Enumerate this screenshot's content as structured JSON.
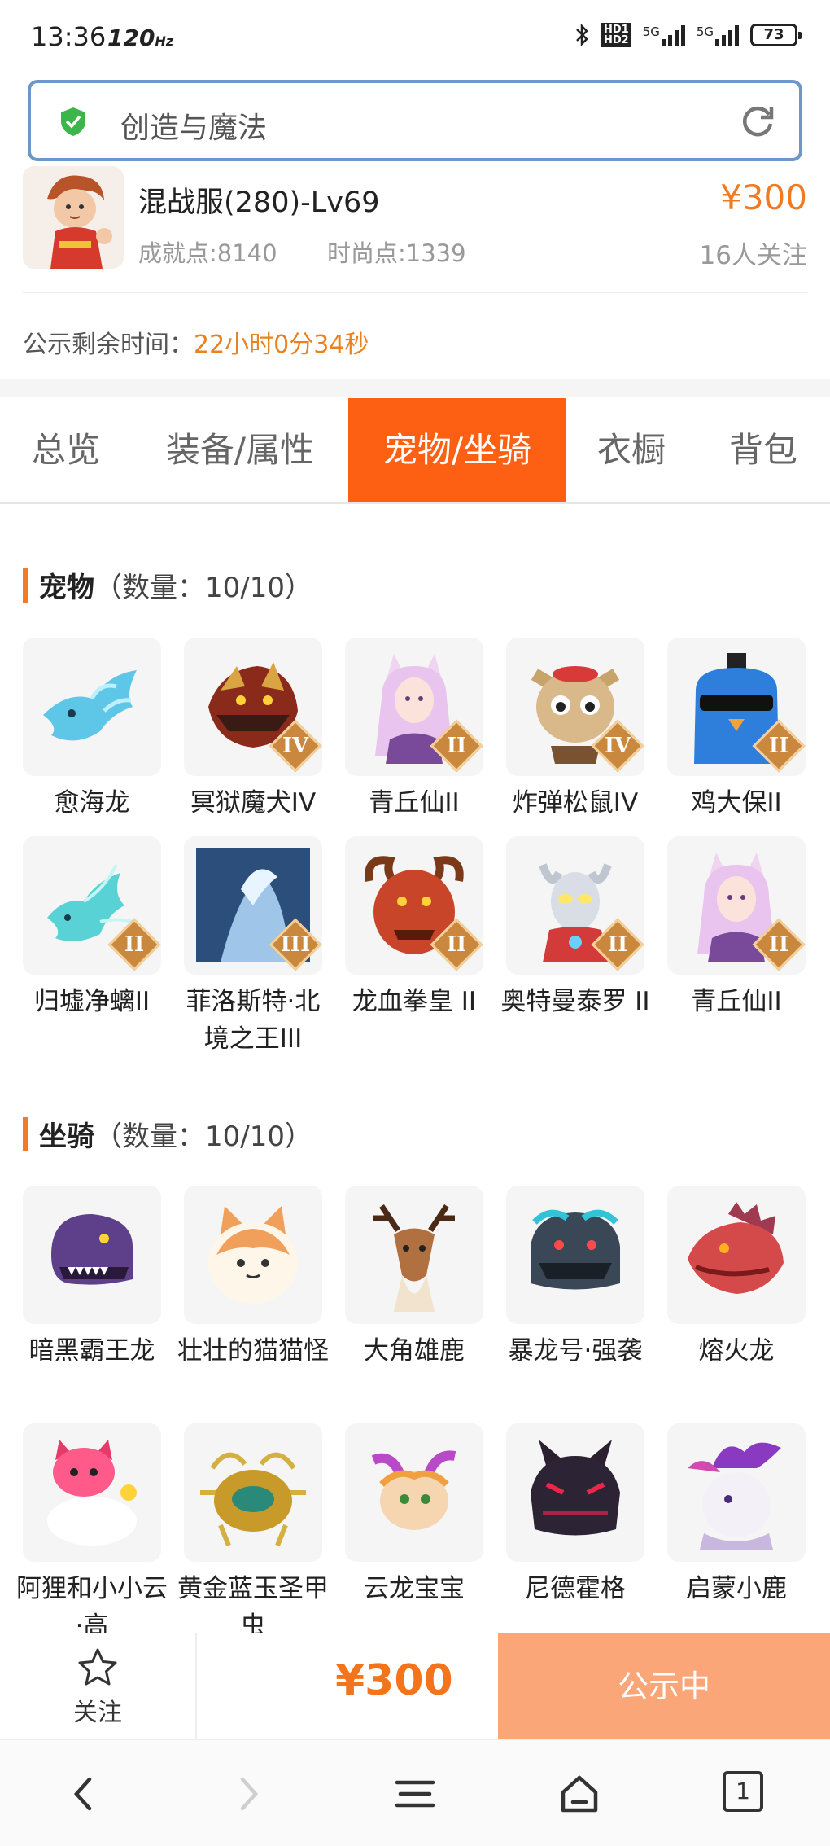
{
  "status_bar": {
    "time": "13:36",
    "refresh_rate": "120",
    "refresh_unit": "Hz",
    "network1": "5G",
    "network2": "5G",
    "battery": "73"
  },
  "search": {
    "query": "创造与魔法"
  },
  "item": {
    "title": "混战服(280)-Lv69",
    "achievement": "成就点:8140",
    "fashion": "时尚点:1339",
    "price": "¥300",
    "followers": "16人关注"
  },
  "countdown": {
    "label": "公示剩余时间：",
    "value": "22小时0分34秒"
  },
  "tabs": [
    {
      "label": "总览"
    },
    {
      "label": "装备/属性"
    },
    {
      "label": "宠物/坐骑"
    },
    {
      "label": "衣橱"
    },
    {
      "label": "背包"
    }
  ],
  "pets": {
    "title": "宠物",
    "count": "（数量：10/10）",
    "items": [
      {
        "name": "愈海龙",
        "tier": "",
        "icon": "blue-dragon"
      },
      {
        "name": "冥狱魔犬IV",
        "tier": "IV",
        "icon": "demon-dog"
      },
      {
        "name": "青丘仙II",
        "tier": "II",
        "icon": "fox-fairy"
      },
      {
        "name": "炸弹松鼠IV",
        "tier": "IV",
        "icon": "bomb-squirrel"
      },
      {
        "name": "鸡大保II",
        "tier": "II",
        "icon": "blue-chicken"
      },
      {
        "name": "归墟净螭II",
        "tier": "II",
        "icon": "cyan-dragon"
      },
      {
        "name": "菲洛斯特·北境之王III",
        "tier": "III",
        "icon": "ice-king"
      },
      {
        "name": "龙血拳皇 II",
        "tier": "II",
        "icon": "dragon-boxer"
      },
      {
        "name": "奥特曼泰罗 II",
        "tier": "II",
        "icon": "ultraman"
      },
      {
        "name": "青丘仙II",
        "tier": "II",
        "icon": "fox-fairy"
      }
    ]
  },
  "mounts": {
    "title": "坐骑",
    "count": "（数量：10/10）",
    "items": [
      {
        "name": "暗黑霸王龙",
        "icon": "dark-trex"
      },
      {
        "name": "壮壮的猫猫怪",
        "icon": "fat-cat"
      },
      {
        "name": "大角雄鹿",
        "icon": "stag"
      },
      {
        "name": "暴龙号·强袭",
        "icon": "mecha-rex"
      },
      {
        "name": "熔火龙",
        "icon": "lava-dragon"
      },
      {
        "name": "阿狸和小小云·高",
        "icon": "ali-cloud"
      },
      {
        "name": "黄金蓝玉圣甲虫",
        "icon": "golden-beetle"
      },
      {
        "name": "云龙宝宝",
        "icon": "cloud-dragon"
      },
      {
        "name": "尼德霍格",
        "icon": "nidhogg"
      },
      {
        "name": "启蒙小鹿",
        "icon": "white-deer"
      }
    ]
  },
  "action_bar": {
    "follow_label": "关注",
    "price": "¥300",
    "status_label": "公示中"
  },
  "nav_bar": {
    "tab_count": "1"
  },
  "colors": {
    "accent": "#fd5f13",
    "price": "#f07a22",
    "countdown": "#e8821e",
    "status_button": "#fba679"
  }
}
